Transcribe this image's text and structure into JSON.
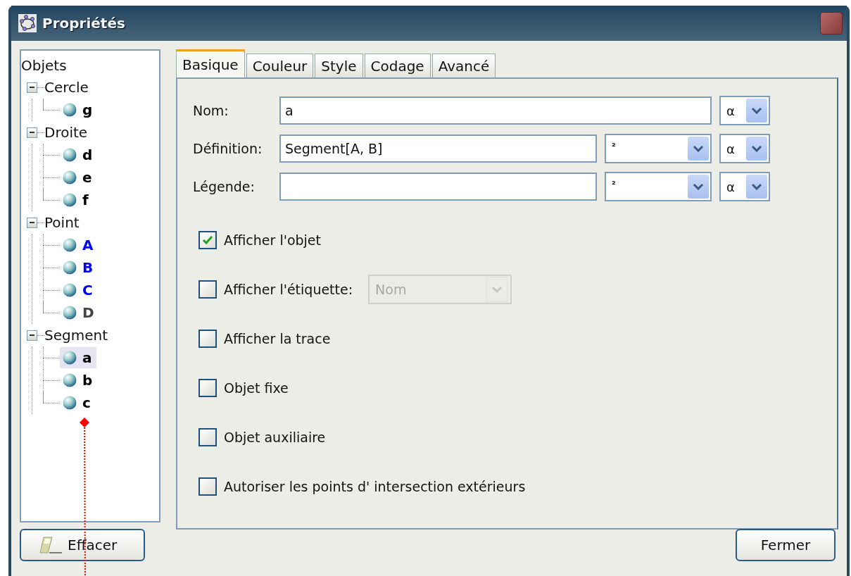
{
  "window": {
    "title": "Propriétés"
  },
  "tree": {
    "label": "Objets",
    "children": [
      {
        "label": "Cercle",
        "expanded": true,
        "children": [
          {
            "label": "g",
            "color": "#000000",
            "selected": false
          }
        ]
      },
      {
        "label": "Droite",
        "expanded": true,
        "children": [
          {
            "label": "d",
            "color": "#000000",
            "selected": false
          },
          {
            "label": "e",
            "color": "#000000",
            "selected": false
          },
          {
            "label": "f",
            "color": "#000000",
            "selected": false
          }
        ]
      },
      {
        "label": "Point",
        "expanded": true,
        "children": [
          {
            "label": "A",
            "color": "#0000ff",
            "selected": false
          },
          {
            "label": "B",
            "color": "#0000ff",
            "selected": false
          },
          {
            "label": "C",
            "color": "#0000ff",
            "selected": false
          },
          {
            "label": "D",
            "color": "#444444",
            "selected": false
          }
        ]
      },
      {
        "label": "Segment",
        "expanded": true,
        "children": [
          {
            "label": "a",
            "color": "#000000",
            "selected": true
          },
          {
            "label": "b",
            "color": "#000000",
            "selected": false
          },
          {
            "label": "c",
            "color": "#000000",
            "selected": false
          }
        ]
      }
    ]
  },
  "tabs": [
    {
      "label": "Basique",
      "selected": true
    },
    {
      "label": "Couleur",
      "selected": false
    },
    {
      "label": "Style",
      "selected": false
    },
    {
      "label": "Codage",
      "selected": false
    },
    {
      "label": "Avancé",
      "selected": false
    }
  ],
  "fields": [
    {
      "label": "Nom:",
      "value": "a",
      "symbol_menu": "α"
    },
    {
      "label": "Définition:",
      "value": "Segment[A, B]",
      "index_menu": "²",
      "symbol_menu": "α"
    },
    {
      "label": "Légende:",
      "index_menu": "²",
      "symbol_menu": "α"
    }
  ],
  "checkboxes": [
    {
      "label": "Afficher l'objet",
      "checked": true
    },
    {
      "label": "Afficher l'étiquette:",
      "checked": false,
      "select": {
        "value": "Nom",
        "disabled": true
      }
    },
    {
      "label": "Afficher la trace",
      "checked": false
    },
    {
      "label": "Objet fixe",
      "checked": false
    },
    {
      "label": "Objet auxiliaire",
      "checked": false
    },
    {
      "label": "Autoriser les points d' intersection extérieurs",
      "checked": false
    }
  ],
  "buttons": {
    "clear": "Effacer",
    "close": "Fermer"
  }
}
